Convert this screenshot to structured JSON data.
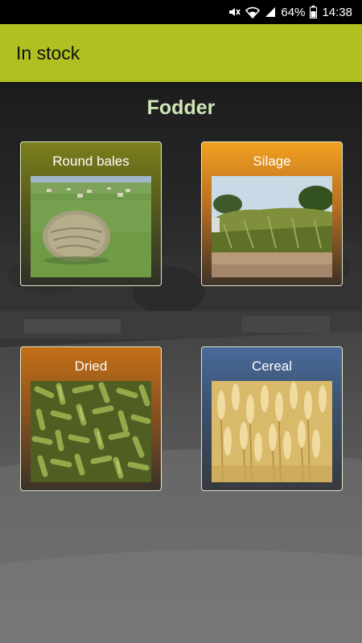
{
  "status_bar": {
    "battery": "64%",
    "time": "14:38"
  },
  "app_bar": {
    "title": "In stock"
  },
  "section": {
    "title": "Fodder"
  },
  "cards": [
    {
      "label": "Round bales"
    },
    {
      "label": "Silage"
    },
    {
      "label": "Dried"
    },
    {
      "label": "Cereal"
    }
  ],
  "colors": {
    "app_bar": "#b0c021",
    "section_title": "#cfe5b7",
    "card_round_bales": "#7b7f1c",
    "card_silage": "#f2a020",
    "card_dried": "#c46f17",
    "card_cereal": "#4a6a9a"
  }
}
